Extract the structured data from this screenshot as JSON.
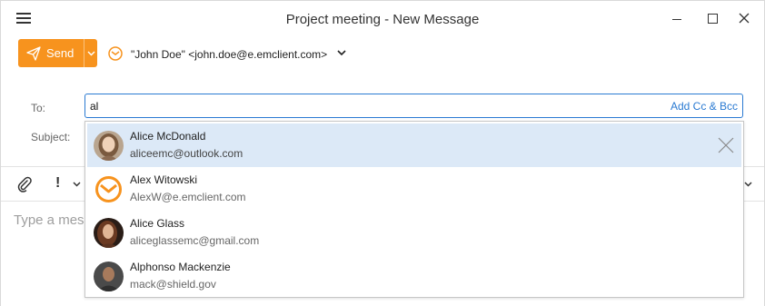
{
  "window": {
    "title": "Project meeting - New Message"
  },
  "toolbar": {
    "send_label": "Send",
    "from": "\"John Doe\" <john.doe@e.emclient.com>"
  },
  "fields": {
    "to_label": "To:",
    "to_value": "al",
    "add_cc_bcc": "Add Cc & Bcc",
    "subject_label": "Subject:"
  },
  "body": {
    "placeholder": "Type a mes"
  },
  "suggestions": [
    {
      "name": "Alice McDonald",
      "email": "aliceemc@outlook.com",
      "selected": true,
      "avatar": "photo"
    },
    {
      "name": "Alex Witowski",
      "email": "AlexW@e.emclient.com",
      "selected": false,
      "avatar": "envelope-icon"
    },
    {
      "name": "Alice Glass",
      "email": "aliceglassemc@gmail.com",
      "selected": false,
      "avatar": "photo"
    },
    {
      "name": "Alphonso Mackenzie",
      "email": "mack@shield.gov",
      "selected": false,
      "avatar": "photo"
    }
  ],
  "colors": {
    "accent": "#f7931e",
    "link": "#2a7ad2",
    "selection": "#dce9f7"
  }
}
